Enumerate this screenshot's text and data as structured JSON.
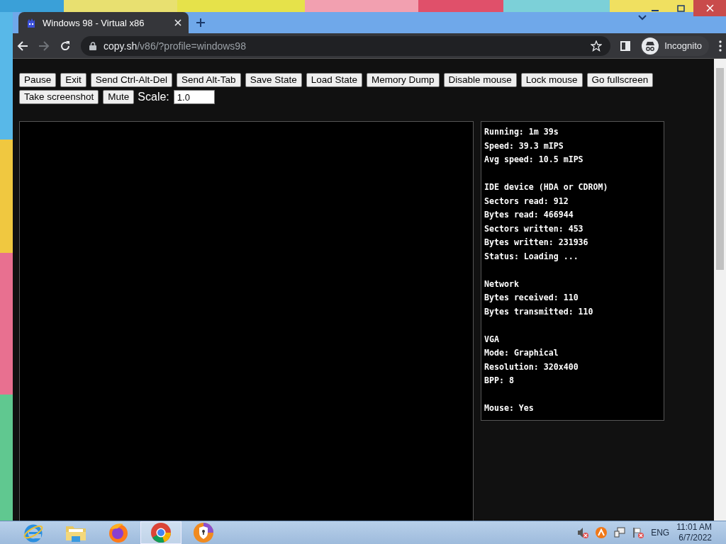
{
  "browser": {
    "tabs": [
      {
        "title": "Windows 98 - Virtual x86",
        "selected": true
      }
    ],
    "address": {
      "host": "copy.sh",
      "path": "/v86/?profile=windows98"
    },
    "profile": "Incognito"
  },
  "emulator": {
    "buttons": [
      "Pause",
      "Exit",
      "Send Ctrl-Alt-Del",
      "Send Alt-Tab",
      "Save State",
      "Load State",
      "Memory Dump",
      "Disable mouse",
      "Lock mouse",
      "Go fullscreen",
      "Take screenshot",
      "Mute"
    ],
    "scale": {
      "label": "Scale:",
      "value": "1.0"
    },
    "stats": [
      {
        "lines": [
          "Running: 1m 39s",
          "Speed: 39.3 mIPS",
          "Avg speed: 10.5 mIPS"
        ]
      },
      {
        "heading": "IDE device (HDA or CDROM)",
        "lines": [
          "Sectors read: 912",
          "Bytes read: 466944",
          "Sectors written: 453",
          "Bytes written: 231936",
          "Status: Loading ..."
        ]
      },
      {
        "heading": "Network",
        "lines": [
          "Bytes received: 110",
          "Bytes transmitted: 110"
        ]
      },
      {
        "heading": "VGA",
        "lines": [
          "Mode: Graphical",
          "Resolution: 320x400",
          "BPP: 8"
        ]
      },
      {
        "lines": [
          "Mouse: Yes"
        ]
      }
    ]
  },
  "taskbar": {
    "apps": [
      {
        "kind": "ie",
        "selected": false
      },
      {
        "kind": "explorer",
        "selected": false
      },
      {
        "kind": "firefox",
        "selected": false
      },
      {
        "kind": "chrome",
        "selected": true
      },
      {
        "kind": "secure-browser",
        "selected": false
      }
    ],
    "tray": {
      "language": "ENG",
      "time": "11:01 AM",
      "date": "6/7/2022"
    }
  }
}
